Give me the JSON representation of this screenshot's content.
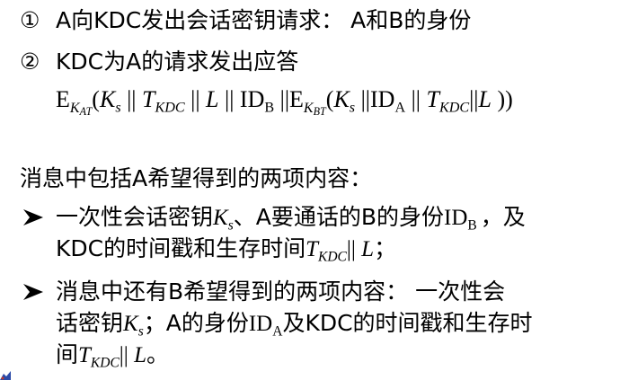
{
  "steps": [
    {
      "marker": "①",
      "text": "A向KDC发出会话密钥请求：  A和B的身份"
    },
    {
      "marker": "②",
      "text": "KDC为A的请求发出应答"
    }
  ],
  "formula": {
    "e1": "E",
    "k1": "K",
    "k1sub": "AT",
    "lp1": "(",
    "ks": "K",
    "ks_sub": "s",
    "sep1": " || ",
    "t": "T",
    "t_sub": "KDC",
    "sep2": " || ",
    "l": "L",
    "sep3": " || ",
    "id": "ID",
    "id_sub": "B",
    "sep4": " ||",
    "e2": "E",
    "k2": "K",
    "k2sub": "BT",
    "lp2": "(",
    "ks2": "K",
    "ks2_sub": "s",
    "sep5": " ||",
    "id2": "ID",
    "id2_sub": "A",
    "sep6": " || ",
    "t2": "T",
    "t2_sub": "KDC",
    "sep7": "||",
    "l2": "L",
    "rp": " ))"
  },
  "summary": "消息中包括A希望得到的两项内容：",
  "bullets": {
    "b1": {
      "p1": "一次性会话密钥",
      "k": "K",
      "k_sub": "s",
      "p2": "、A要通话的B的身份",
      "id": "ID",
      "id_sub": "B",
      "p3": "，及",
      "p4": "KDC的时间戳和生存时间",
      "t": "T",
      "t_sub": "KDC",
      "sep": "|| ",
      "l": "L",
      "p5": "；"
    },
    "b2": {
      "p1": "消息中还有B希望得到的两项内容：  一次性会",
      "p2": "话密钥",
      "k": "K",
      "k_sub": "s",
      "p3": "；A的身份",
      "id": "ID",
      "id_sub": "A",
      "p4": "及KDC的时间戳和生存时",
      "p5": "间",
      "t": "T",
      "t_sub": "KDC",
      "sep": "|| ",
      "l": "L",
      "p6": "。"
    }
  },
  "icons": {
    "bullet": "arrowhead-bullet-icon"
  }
}
